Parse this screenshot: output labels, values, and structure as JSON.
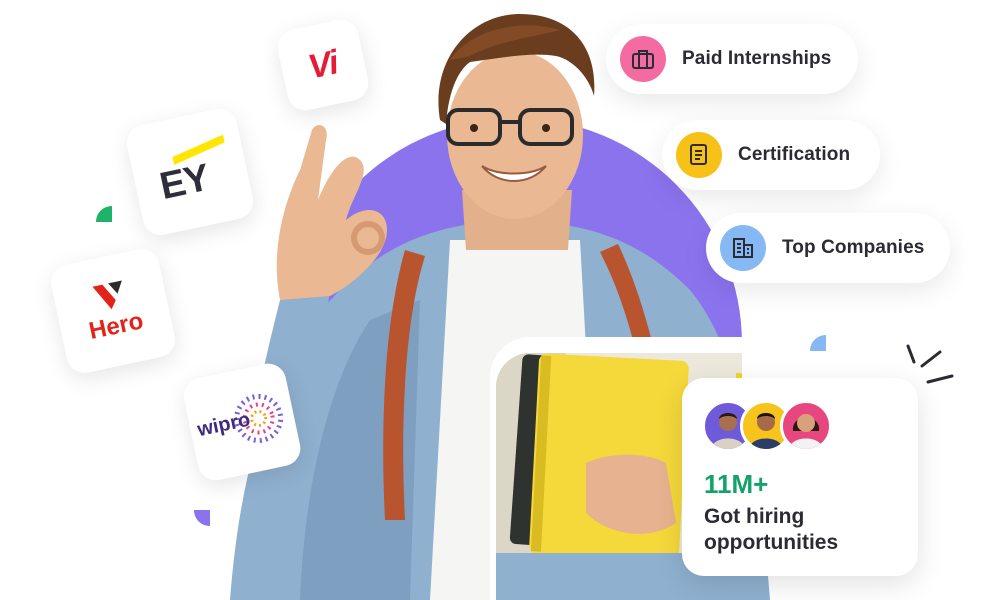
{
  "features": [
    {
      "label": "Paid Internships",
      "icon": "briefcase-icon",
      "color": "#f36ba0"
    },
    {
      "label": "Certification",
      "icon": "certificate-icon",
      "color": "#f7c117"
    },
    {
      "label": "Top Companies",
      "icon": "building-icon",
      "color": "#86b9f3"
    }
  ],
  "logos": {
    "vi": "Vi",
    "ey": "EY",
    "hero": "Hero",
    "wipro": "wipro"
  },
  "stats": {
    "value": "11M+",
    "caption": "Got hiring opportunities"
  },
  "colors": {
    "arch": "#8b73ee",
    "stat_green": "#13a36a",
    "accent_yellow": "#f7d21e",
    "accent_blue": "#86b9f3",
    "accent_green": "#1fb36a"
  }
}
